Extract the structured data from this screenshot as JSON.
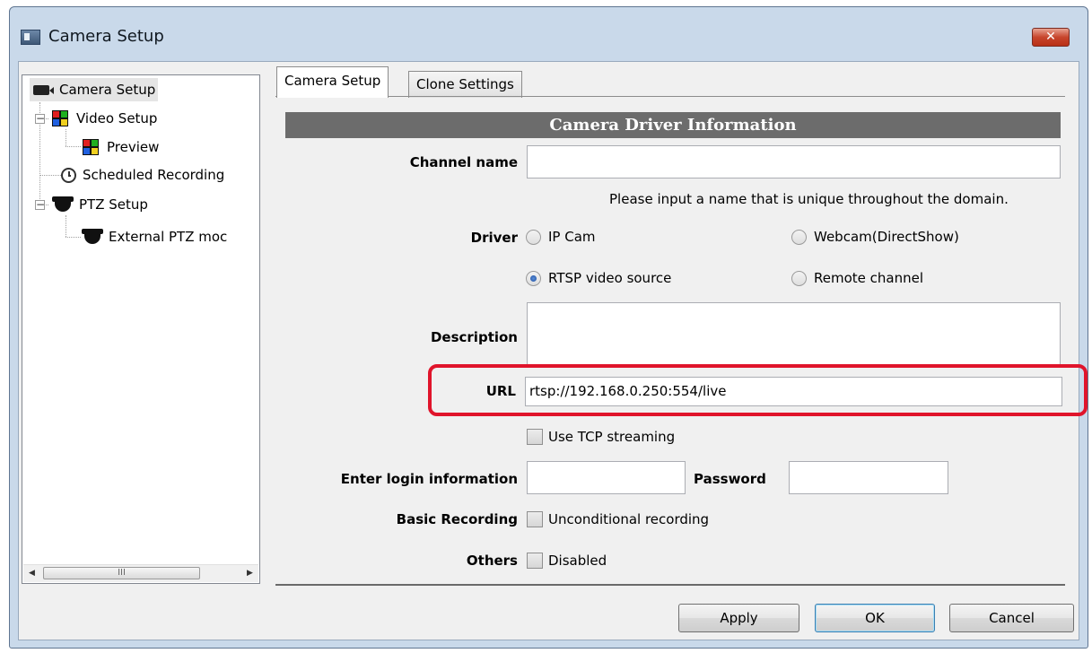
{
  "window": {
    "title": "Camera Setup",
    "close_glyph": "✕"
  },
  "tree": {
    "items": [
      {
        "label": "Camera Setup",
        "icon": "camera-icon"
      },
      {
        "label": "Video Setup",
        "icon": "color-grid-icon"
      },
      {
        "label": "Preview",
        "icon": "color-grid-icon"
      },
      {
        "label": "Scheduled Recording",
        "icon": "clock-icon"
      },
      {
        "label": "PTZ Setup",
        "icon": "dome-camera-icon"
      },
      {
        "label": "External PTZ moc",
        "icon": "dome-camera-icon"
      }
    ],
    "expander_glyph": "−",
    "scroll_left": "◀",
    "scroll_right": "▶",
    "scroll_grip": "III"
  },
  "tabs": [
    {
      "label": "Camera Setup",
      "active": true
    },
    {
      "label": "Clone Settings",
      "active": false
    }
  ],
  "form": {
    "section_title": "Camera Driver Information",
    "channel_name": {
      "label": "Channel name",
      "value": ""
    },
    "hint": "Please input a name that is unique throughout the domain.",
    "driver": {
      "label": "Driver",
      "options": [
        {
          "label": "IP Cam",
          "checked": false
        },
        {
          "label": "Webcam(DirectShow)",
          "checked": false
        },
        {
          "label": "RTSP video source",
          "checked": true
        },
        {
          "label": "Remote channel",
          "checked": false
        }
      ]
    },
    "description": {
      "label": "Description",
      "value": ""
    },
    "url": {
      "label": "URL",
      "value": "rtsp://192.168.0.250:554/live"
    },
    "tcp": {
      "label": "Use TCP streaming",
      "checked": false
    },
    "login": {
      "label": "Enter login information",
      "value": ""
    },
    "password": {
      "label": "Password",
      "value": ""
    },
    "basic_recording": {
      "label": "Basic Recording",
      "option": "Unconditional recording",
      "checked": false
    },
    "others": {
      "label": "Others",
      "option": "Disabled",
      "checked": false
    }
  },
  "buttons": {
    "apply": "Apply",
    "ok": "OK",
    "cancel": "Cancel"
  },
  "colors": {
    "highlight": "#e0142b",
    "section_header": "#6c6c6c",
    "window_frame": "#c9d9ea"
  }
}
